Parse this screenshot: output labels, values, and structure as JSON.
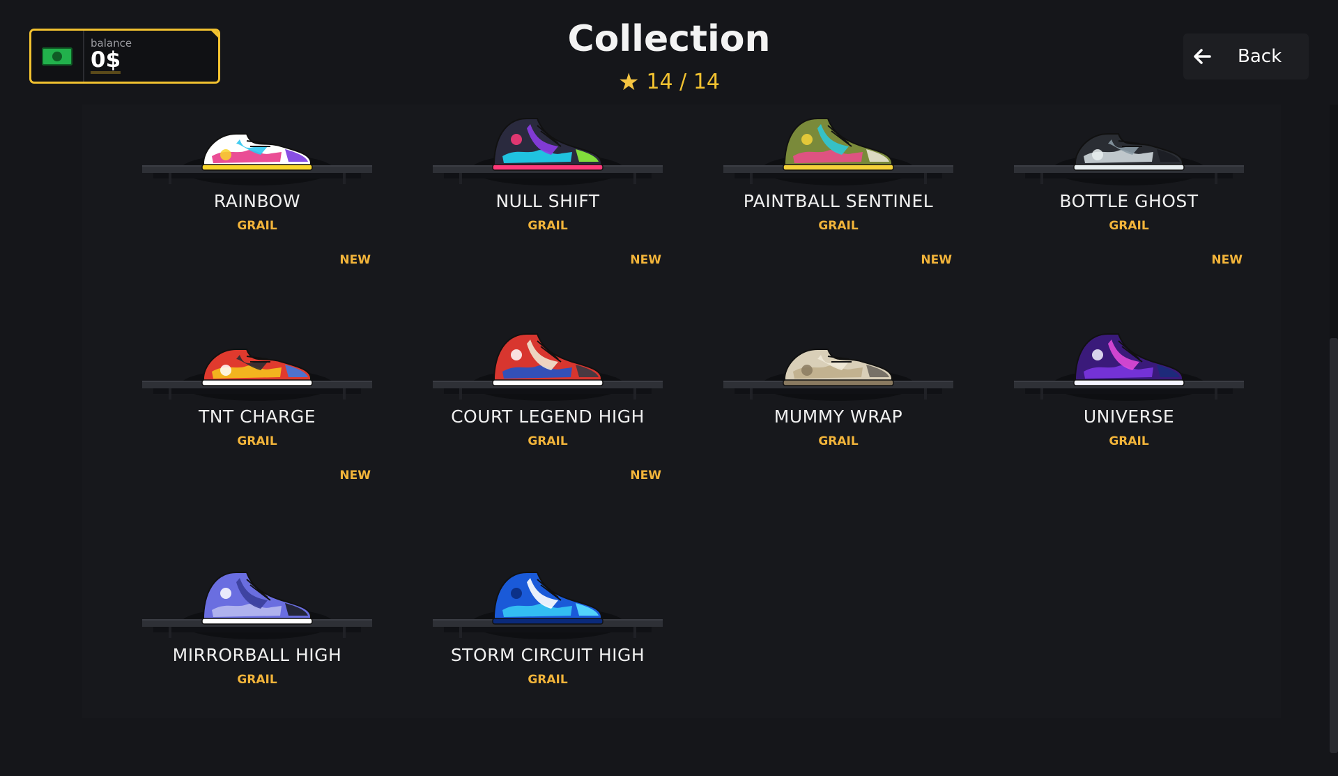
{
  "header": {
    "title": "Collection",
    "progress": "14 / 14"
  },
  "balance": {
    "label": "balance",
    "value": "0$"
  },
  "back": {
    "label": "Back"
  },
  "items": [
    {
      "name": "RAINBOW",
      "rarity": "GRAIL",
      "new": "NEW",
      "colors": [
        "#ffffff",
        "#e83a8a",
        "#2fc6f0",
        "#f8d52a",
        "#7b3ce0"
      ]
    },
    {
      "name": "NULL SHIFT",
      "rarity": "GRAIL",
      "new": "NEW",
      "colors": [
        "#2a2a3e",
        "#1fd3f2",
        "#8b3de6",
        "#ff3a7a",
        "#8cf03c"
      ]
    },
    {
      "name": "PAINTBALL SENTINEL",
      "rarity": "GRAIL",
      "new": "NEW",
      "colors": [
        "#7a8a3a",
        "#e94c8a",
        "#2fc6d6",
        "#f5d23a",
        "#e6e2cf"
      ]
    },
    {
      "name": "BOTTLE GHOST",
      "rarity": "GRAIL",
      "new": "NEW",
      "colors": [
        "#2a2d33",
        "#cfd8dc",
        "#8a9aa4",
        "#e8eef0",
        "#1b1d22"
      ]
    },
    {
      "name": "TNT CHARGE",
      "rarity": "GRAIL",
      "new": "NEW",
      "colors": [
        "#e03a2e",
        "#f5c21e",
        "#2c2c32",
        "#ffffff",
        "#3f79e0"
      ]
    },
    {
      "name": "COURT LEGEND HIGH",
      "rarity": "GRAIL",
      "new": "NEW",
      "colors": [
        "#d8362f",
        "#2153c8",
        "#f0e6d2",
        "#ffffff",
        "#3a3a44"
      ]
    },
    {
      "name": "MUMMY WRAP",
      "rarity": "GRAIL",
      "new": "",
      "colors": [
        "#d9cfb8",
        "#bfae8c",
        "#f0e9d8",
        "#8a7a60",
        "#6b665e"
      ]
    },
    {
      "name": "UNIVERSE",
      "rarity": "GRAIL",
      "new": "",
      "colors": [
        "#3a1a7a",
        "#7b35e0",
        "#e04ad8",
        "#f4f4ff",
        "#1b2c7a"
      ]
    },
    {
      "name": "MIRRORBALL HIGH",
      "rarity": "GRAIL",
      "new": "",
      "colors": [
        "#6a6ee0",
        "#b7b9f0",
        "#3a3e9a",
        "#ffffff",
        "#1d1e28"
      ]
    },
    {
      "name": "STORM CIRCUIT HIGH",
      "rarity": "GRAIL",
      "new": "",
      "colors": [
        "#1a5ad8",
        "#36c8f5",
        "#ffffff",
        "#0b2a7a",
        "#5ae0ff"
      ]
    }
  ]
}
